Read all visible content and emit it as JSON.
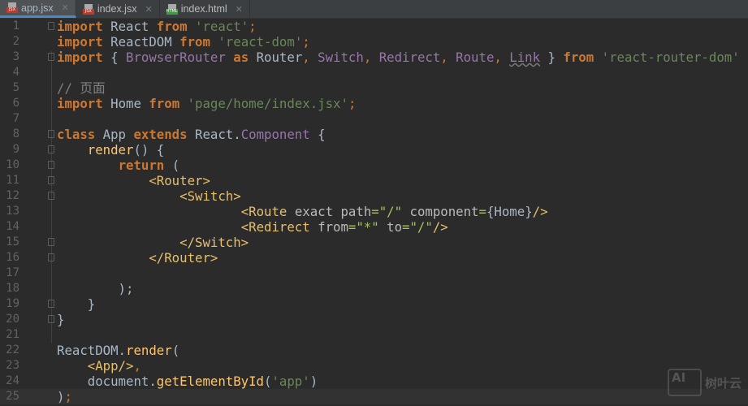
{
  "tabs": [
    {
      "label": "app.jsx",
      "type": "jsx",
      "active": true
    },
    {
      "label": "index.jsx",
      "type": "jsx",
      "active": false
    },
    {
      "label": "index.html",
      "type": "html",
      "active": false
    }
  ],
  "current_line": 25,
  "fold_lines": [
    1,
    3,
    8,
    9,
    10,
    11,
    12,
    15,
    16,
    19,
    20
  ],
  "lines": [
    [
      [
        "kw",
        "import"
      ],
      [
        "",
        "React "
      ],
      [
        "kw",
        "from "
      ],
      [
        "str",
        "'react'"
      ],
      [
        "punc",
        ";"
      ]
    ],
    [
      [
        "kw",
        "import"
      ],
      [
        "",
        "ReactDOM "
      ],
      [
        "kw",
        "from "
      ],
      [
        "str",
        "'react-dom'"
      ],
      [
        "punc",
        ";"
      ]
    ],
    [
      [
        "kw",
        "import"
      ],
      [
        "",
        "{ "
      ],
      [
        "cls",
        "BrowserRouter "
      ],
      [
        "kw",
        "as "
      ],
      [
        "",
        "Router"
      ],
      [
        "punc",
        ", "
      ],
      [
        "cls",
        "Switch"
      ],
      [
        "punc",
        ", "
      ],
      [
        "cls",
        "Redirect"
      ],
      [
        "punc",
        ", "
      ],
      [
        "cls",
        "Route"
      ],
      [
        "punc",
        ", "
      ],
      [
        "cls u",
        "Link"
      ],
      [
        "",
        " } "
      ],
      [
        "kw",
        "from "
      ],
      [
        "str",
        "'react-router-dom'"
      ]
    ],
    [],
    [
      [
        "cmt",
        "// 页面"
      ]
    ],
    [
      [
        "kw",
        "import"
      ],
      [
        "",
        "Home "
      ],
      [
        "kw",
        "from "
      ],
      [
        "str",
        "'page/home/index.jsx'"
      ],
      [
        "punc",
        ";"
      ]
    ],
    [],
    [
      [
        "kw",
        "class "
      ],
      [
        "",
        "App "
      ],
      [
        "kw",
        "extends "
      ],
      [
        "",
        "React."
      ],
      [
        "cls",
        "Component"
      ],
      [
        "",
        " {"
      ]
    ],
    [
      [
        "",
        "    "
      ],
      [
        "fn",
        "render"
      ],
      [
        "",
        "() {"
      ]
    ],
    [
      [
        "",
        "        "
      ],
      [
        "kw",
        "return "
      ],
      [
        "",
        "("
      ]
    ],
    [
      [
        "",
        "            "
      ],
      [
        "tag",
        "<Router>"
      ]
    ],
    [
      [
        "",
        "                "
      ],
      [
        "tag",
        "<Switch>"
      ]
    ],
    [
      [
        "",
        "                        "
      ],
      [
        "tag",
        "<Route "
      ],
      [
        "attr",
        "exact path"
      ],
      [
        "aval",
        "=\"/\" "
      ],
      [
        "attr",
        "component"
      ],
      [
        "aval",
        "="
      ],
      [
        "",
        "{Home}"
      ],
      [
        "tag",
        "/>"
      ]
    ],
    [
      [
        "",
        "                        "
      ],
      [
        "tag",
        "<Redirect "
      ],
      [
        "attr",
        "from"
      ],
      [
        "aval",
        "=\"*\" "
      ],
      [
        "attr",
        "to"
      ],
      [
        "aval",
        "=\"/\""
      ],
      [
        "tag",
        "/>"
      ]
    ],
    [
      [
        "",
        "                "
      ],
      [
        "tag",
        "</Switch>"
      ]
    ],
    [
      [
        "",
        "            "
      ],
      [
        "tag",
        "</Router>"
      ]
    ],
    [],
    [
      [
        "",
        "        );"
      ]
    ],
    [
      [
        "",
        "    }"
      ]
    ],
    [
      [
        "",
        "}"
      ]
    ],
    [],
    [
      [
        "",
        "ReactDOM."
      ],
      [
        "fn",
        "render"
      ],
      [
        "",
        "("
      ]
    ],
    [
      [
        "",
        "    "
      ],
      [
        "tag",
        "<App/>"
      ],
      [
        "punc",
        ","
      ]
    ],
    [
      [
        "",
        "    document."
      ],
      [
        "fn",
        "getElementById"
      ],
      [
        "",
        "("
      ],
      [
        "str",
        "'app'"
      ],
      [
        "",
        ")"
      ]
    ],
    [
      [
        "",
        ")"
      ],
      [
        "punc",
        ";"
      ]
    ]
  ],
  "watermark": {
    "logo": "AI",
    "text": "树叶云"
  }
}
